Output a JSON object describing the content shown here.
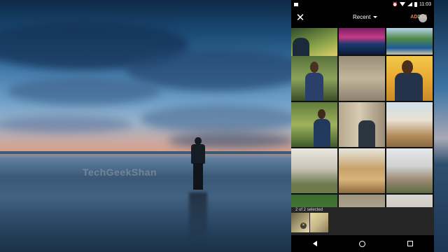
{
  "wallpaper": {
    "watermark": "TechGeekShan"
  },
  "statusbar": {
    "time": "11:03"
  },
  "picker": {
    "sort_label": "Recent",
    "add_label": "ADD(2)"
  },
  "photos": [
    {
      "desc": "portrait-outdoor-1"
    },
    {
      "desc": "city-night"
    },
    {
      "desc": "beach-resort"
    },
    {
      "desc": "portrait-blue-shirt"
    },
    {
      "desc": "wall-interior"
    },
    {
      "desc": "portrait-doorway"
    },
    {
      "desc": "portrait-closeup"
    },
    {
      "desc": "portrait-garden"
    },
    {
      "desc": "portrait-door"
    },
    {
      "desc": "house-exterior-1"
    },
    {
      "desc": "house-exterior-2"
    },
    {
      "desc": "house-exterior-3"
    },
    {
      "desc": "house-exterior-4"
    },
    {
      "desc": "house-exterior-5"
    },
    {
      "desc": "portrait-partial"
    },
    {
      "desc": "roof-partial"
    },
    {
      "desc": "building-partial"
    }
  ],
  "selection": {
    "label": "2 of 2 selected"
  },
  "colors": {
    "accent": "#ff7a3d",
    "panel": "#1b1b1b",
    "bar": "#000000"
  }
}
